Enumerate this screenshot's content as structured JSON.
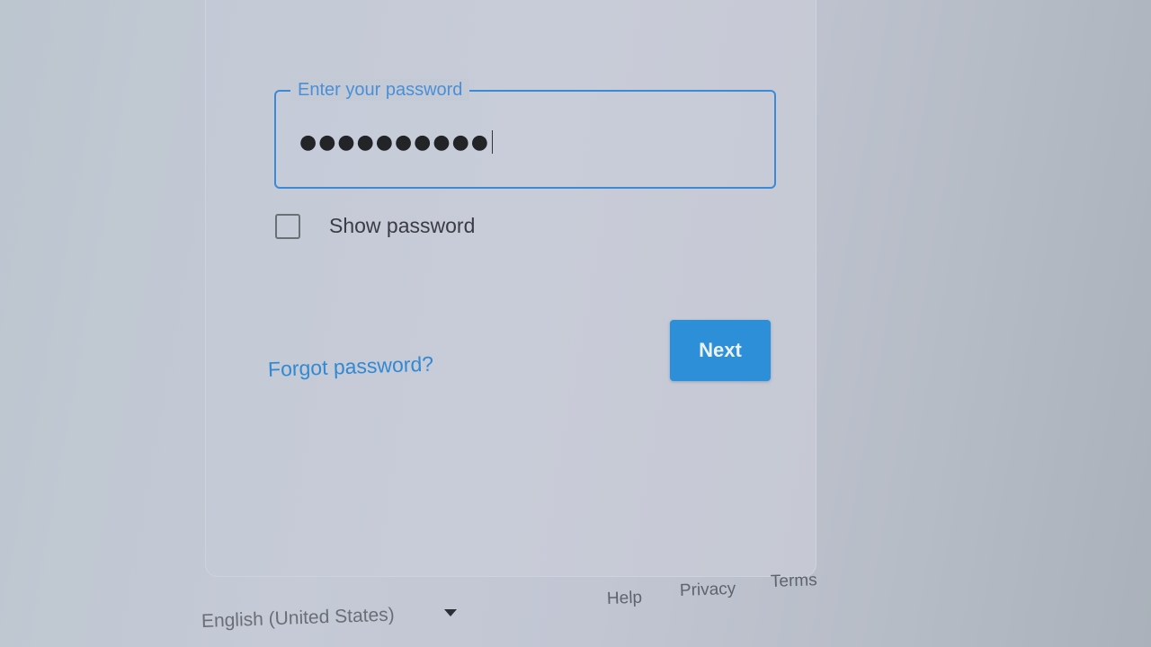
{
  "password_field": {
    "label": "Enter your password",
    "value": "●●●●●●●●●●"
  },
  "show_password": {
    "label": "Show password",
    "checked": false
  },
  "forgot_password": {
    "label": "Forgot password?"
  },
  "next_button": {
    "label": "Next"
  },
  "footer": {
    "language": "English (United States)",
    "links": {
      "help": "Help",
      "privacy": "Privacy",
      "terms": "Terms"
    }
  },
  "colors": {
    "accent": "#2d8fd7",
    "link": "#3189d1"
  },
  "icons": {
    "language_dropdown": "caret-down-icon"
  }
}
